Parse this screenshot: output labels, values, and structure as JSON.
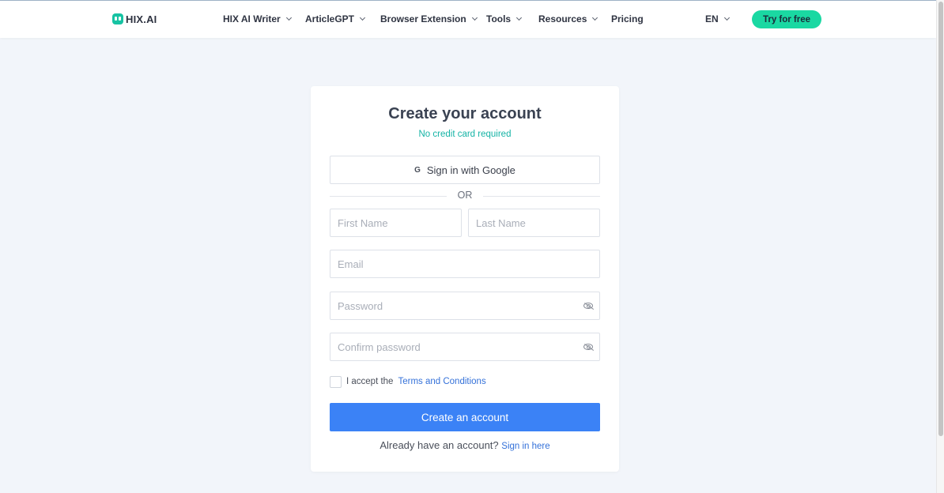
{
  "header": {
    "logo_text": "HIX.AI",
    "nav": [
      {
        "label": "HIX AI Writer"
      },
      {
        "label": "ArticleGPT"
      },
      {
        "label": "Browser Extension"
      },
      {
        "label": "Tools"
      },
      {
        "label": "Resources"
      },
      {
        "label": "Pricing"
      }
    ],
    "language": "EN",
    "cta_label": "Try for free"
  },
  "form": {
    "title": "Create your account",
    "subtitle": "No credit card required",
    "google_icon": "G",
    "google_label": "Sign in with Google",
    "divider_text": "OR",
    "first_name_placeholder": "First Name",
    "last_name_placeholder": "Last Name",
    "email_placeholder": "Email",
    "password_placeholder": "Password",
    "confirm_placeholder": "Confirm password",
    "accept_text": "I accept the",
    "terms_link": "Terms and Conditions",
    "submit_label": "Create an account",
    "have_account_text": "Already have an account?",
    "signin_link": "Sign in here"
  },
  "colors": {
    "accent_teal": "#17c3a3",
    "cta_green": "#1ad8a2",
    "primary_blue": "#3b82f6",
    "link_blue": "#3471d9",
    "background": "#f2f5fa"
  },
  "icons": [
    "hix-logo-icon",
    "chevron-down-icon",
    "google-icon",
    "eye-slash-icon"
  ]
}
